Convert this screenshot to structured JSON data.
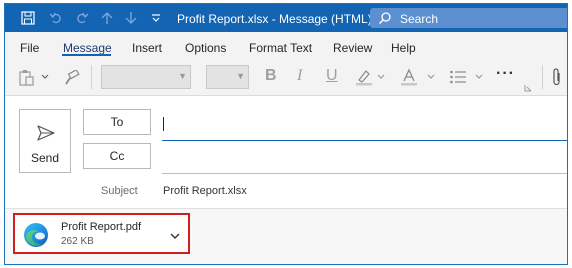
{
  "window": {
    "title": "Profit Report.xlsx  -  Message (HTML)",
    "search_label": "Search"
  },
  "quick_access": {
    "icons": [
      "save-icon",
      "undo-icon",
      "redo-icon",
      "up-arrow-icon",
      "down-arrow-icon",
      "customize-dropdown-icon"
    ]
  },
  "menu": {
    "tabs": [
      "File",
      "Message",
      "Insert",
      "Options",
      "Format Text",
      "Review",
      "Help"
    ],
    "active": "Message"
  },
  "ribbon": {
    "font_name_value": "",
    "font_size_value": "",
    "format_buttons": [
      "B",
      "I",
      "U"
    ],
    "more_label": "···",
    "icons": [
      "paste-icon",
      "format-painter-icon",
      "highlight-icon",
      "font-color-icon",
      "bullets-icon",
      "more-icon",
      "attach-icon"
    ]
  },
  "compose": {
    "send_label": "Send",
    "to_label": "To",
    "cc_label": "Cc",
    "to_value": "",
    "cc_value": "",
    "subject_label": "Subject",
    "subject_value": "Profit Report.xlsx"
  },
  "attachment": {
    "name": "Profit Report.pdf",
    "size": "262 KB",
    "icon": "edge-icon",
    "highlight_color": "#d21d1d"
  },
  "colors": {
    "titlebar": "#1464b4",
    "accent": "#1464b4"
  }
}
